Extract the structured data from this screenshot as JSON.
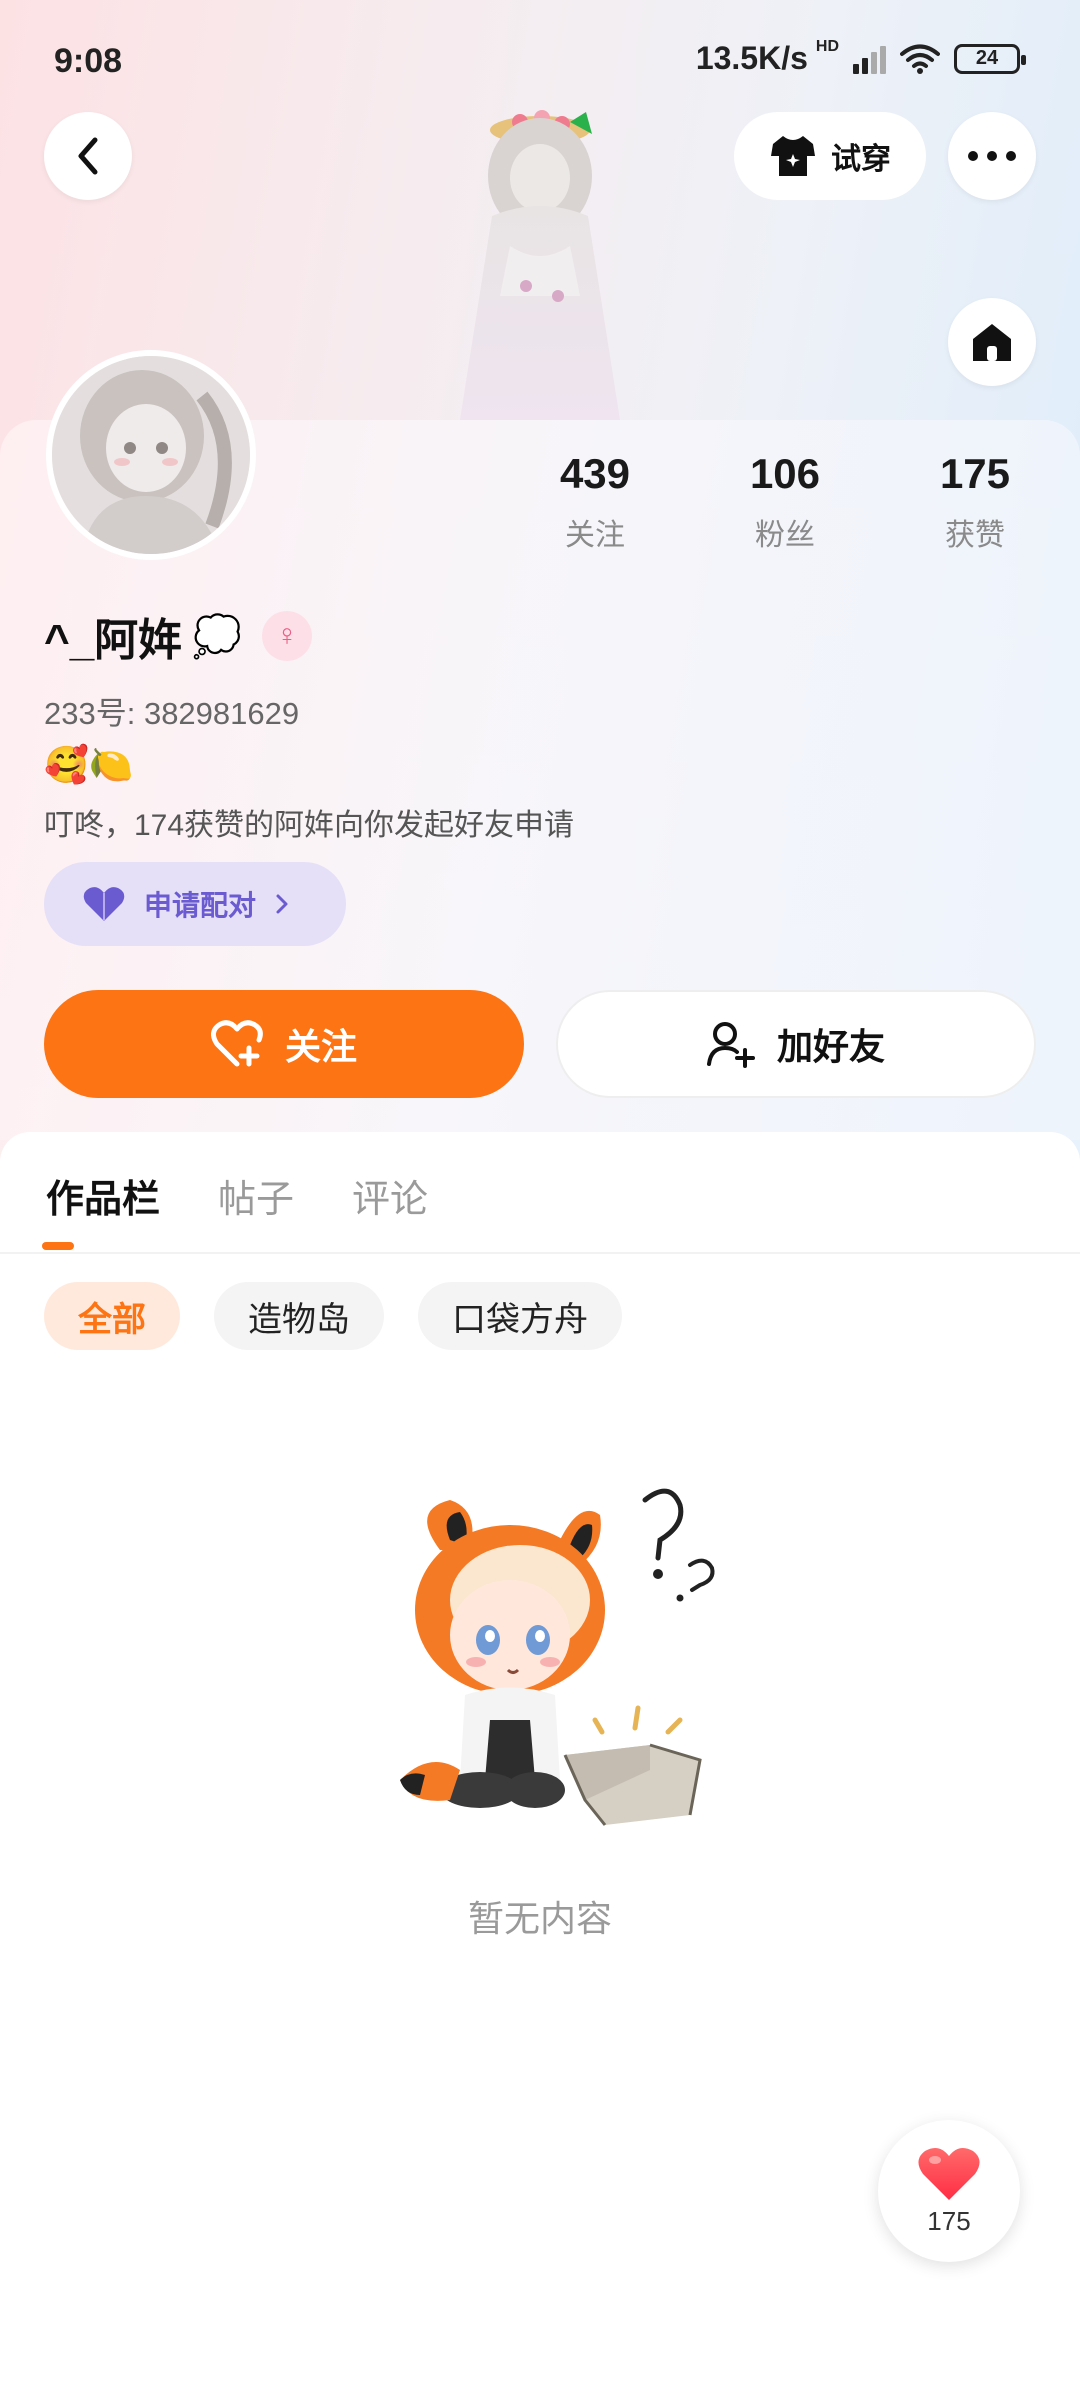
{
  "status_bar": {
    "time": "9:08",
    "net_speed": "13.5K/s",
    "hd": "HD",
    "battery": "24",
    "icons": [
      "signal-icon",
      "wifi-icon",
      "battery-icon"
    ]
  },
  "top_actions": {
    "try_on_label": "试穿",
    "icons": [
      "back-arrow-icon",
      "shirt-icon",
      "more-dots-icon",
      "home-icon"
    ]
  },
  "profile": {
    "stats": [
      {
        "value": "439",
        "label": "关注"
      },
      {
        "value": "106",
        "label": "粉丝"
      },
      {
        "value": "175",
        "label": "获赞"
      }
    ],
    "username": "^_阿姩",
    "thought_emoji": "💭",
    "gender_symbol": "♀",
    "uid": "233号: 382981629",
    "emoji_line": "🥰🍋",
    "bio": "叮咚，174获赞的阿姩向你发起好友申请",
    "pair_button": "申请配对",
    "follow_button": "关注",
    "add_friend_button": "加好友"
  },
  "tabs": [
    "作品栏",
    "帖子",
    "评论"
  ],
  "filters": [
    "全部",
    "造物岛",
    "口袋方舟"
  ],
  "empty_state": "暂无内容",
  "like_fab": {
    "count": "175"
  },
  "colors": {
    "accent": "#fd7414",
    "pair_purple": "#6b5bd0",
    "pair_bg": "#e5e0f7",
    "like_red": "#ff3b4e"
  }
}
